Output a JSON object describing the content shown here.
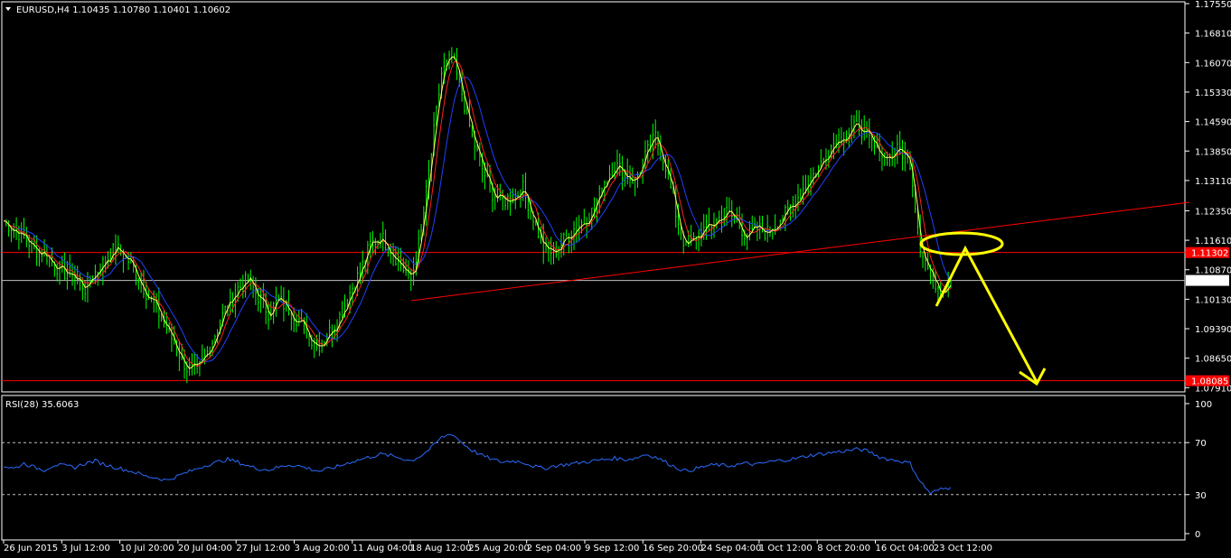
{
  "window": {
    "symbol_header": "EURUSD,H4  1.10435 1.10780 1.10401 1.10602",
    "indicator_header": "RSI(28) 35.6063"
  },
  "colors": {
    "background": "#000000",
    "candles": "#00ff00",
    "axis": "#ffffff",
    "ma_fast": "#ffff66",
    "ma_mid": "#ff2020",
    "ma_slow": "#2040ff",
    "levels": "#ff0000",
    "price_line": "#c0c0c0",
    "annotation": "#ffff00",
    "rsi_line": "#2a6bff",
    "rsi_levels": "#c0c0c0"
  },
  "chart_data": [
    {
      "type": "line",
      "title": "EURUSD,H4",
      "ohlc_last": {
        "open": 1.10435,
        "high": 1.1078,
        "low": 1.10401,
        "close": 1.10602
      },
      "y_ticks": [
        "1.17550",
        "1.16810",
        "1.16070",
        "1.15330",
        "1.14590",
        "1.13850",
        "1.13110",
        "1.12350",
        "1.11610",
        "1.10870",
        "1.10130",
        "1.09390",
        "1.08650",
        "1.07910"
      ],
      "ylim": [
        1.0785,
        1.1755
      ],
      "x_ticks": [
        "26 Jun 2015",
        "3 Jul 12:00",
        "10 Jul 20:00",
        "20 Jul 04:00",
        "27 Jul 12:00",
        "3 Aug 20:00",
        "11 Aug 04:00",
        "18 Aug 12:00",
        "25 Aug 20:00",
        "2 Sep 04:00",
        "9 Sep 12:00",
        "16 Sep 20:00",
        "24 Sep 04:00",
        "1 Oct 12:00",
        "8 Oct 20:00",
        "16 Oct 04:00",
        "23 Oct 12:00"
      ],
      "series": [
        {
          "values": [
            1.121,
            1.119,
            1.117,
            1.114,
            1.113,
            1.11,
            1.108,
            1.107,
            1.104,
            1.108,
            1.111,
            1.114,
            1.112,
            1.108,
            1.103,
            1.099,
            1.094,
            1.089,
            1.084,
            1.083,
            1.088,
            1.094,
            1.1,
            1.104,
            1.106,
            1.102,
            1.098,
            1.101,
            1.099,
            1.096,
            1.092,
            1.09,
            1.093,
            1.097,
            1.103,
            1.108,
            1.115,
            1.117,
            1.114,
            1.11,
            1.106,
            1.118,
            1.138,
            1.158,
            1.162,
            1.153,
            1.142,
            1.134,
            1.128,
            1.126,
            1.127,
            1.129,
            1.122,
            1.114,
            1.113,
            1.116,
            1.119,
            1.121,
            1.124,
            1.131,
            1.135,
            1.133,
            1.131,
            1.137,
            1.142,
            1.135,
            1.123,
            1.114,
            1.117,
            1.119,
            1.121,
            1.123,
            1.121,
            1.117,
            1.119,
            1.118,
            1.121,
            1.123,
            1.127,
            1.131,
            1.134,
            1.139,
            1.142,
            1.143,
            1.145,
            1.141,
            1.138,
            1.137,
            1.139,
            1.136,
            1.115,
            1.107,
            1.104,
            1.106
          ]
        }
      ],
      "levels": [
        1.11302,
        1.08085
      ],
      "level_labels": [
        "1.11302",
        "1.08085"
      ],
      "current_price": 1.10602,
      "current_price_label": "1.10602"
    },
    {
      "type": "line",
      "title": "RSI(28) 35.6063",
      "y_ticks": [
        "100",
        "70",
        "30",
        "0"
      ],
      "ylim": [
        0,
        100
      ],
      "levels": [
        70,
        30
      ],
      "series": [
        {
          "values": [
            52,
            50,
            54,
            51,
            49,
            53,
            52,
            51,
            54,
            56,
            53,
            51,
            49,
            47,
            44,
            43,
            41,
            44,
            47,
            50,
            53,
            55,
            57,
            55,
            52,
            50,
            49,
            51,
            53,
            52,
            50,
            48,
            50,
            52,
            55,
            57,
            59,
            61,
            60,
            58,
            56,
            60,
            66,
            74,
            77,
            70,
            64,
            60,
            57,
            55,
            56,
            55,
            52,
            50,
            52,
            53,
            54,
            55,
            56,
            57,
            58,
            57,
            58,
            61,
            59,
            55,
            51,
            48,
            50,
            52,
            53,
            52,
            53,
            54,
            53,
            55,
            56,
            57,
            58,
            60,
            61,
            62,
            63,
            64,
            65,
            63,
            59,
            57,
            56,
            54,
            40,
            31,
            34,
            35.6
          ]
        }
      ]
    }
  ]
}
